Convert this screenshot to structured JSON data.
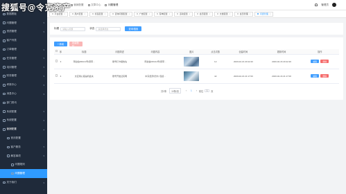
{
  "watermark": "搜狐号@令克资产",
  "header": {
    "breadcrumb": [
      "首页",
      "营销配置",
      "文章中心",
      "问题管理"
    ],
    "user": "管理员"
  },
  "tabs": [
    {
      "label": "平台配置",
      "active": false
    },
    {
      "label": "用户配置",
      "active": false
    },
    {
      "label": "标签配置",
      "active": false
    },
    {
      "label": "咨询问题配置",
      "active": false
    },
    {
      "label": "广告配置",
      "active": false
    },
    {
      "label": "菜单配置",
      "active": false
    },
    {
      "label": "活动配置",
      "active": false
    },
    {
      "label": "会员配置",
      "active": false
    },
    {
      "label": "文章配置",
      "active": false
    },
    {
      "label": "会员管理",
      "active": false
    },
    {
      "label": "问题管理",
      "active": true
    }
  ],
  "sidebar": {
    "items": [
      {
        "label": "数据看板",
        "level": 0,
        "arrow": false,
        "state": ""
      },
      {
        "label": "问题管理",
        "level": 0,
        "arrow": true,
        "state": ""
      },
      {
        "label": "资质管理",
        "level": 0,
        "arrow": true,
        "state": ""
      },
      {
        "label": "客户列表",
        "level": 0,
        "arrow": false,
        "state": ""
      },
      {
        "label": "订单管理",
        "level": 0,
        "arrow": true,
        "state": ""
      },
      {
        "label": "任务管理",
        "level": 0,
        "arrow": true,
        "state": ""
      },
      {
        "label": "培训管理",
        "level": 0,
        "arrow": true,
        "state": ""
      },
      {
        "label": "财务管理",
        "level": 0,
        "arrow": true,
        "state": ""
      },
      {
        "label": "考核中心",
        "level": 0,
        "arrow": true,
        "state": ""
      },
      {
        "label": "消息中心",
        "level": 0,
        "arrow": true,
        "state": ""
      },
      {
        "label": "部门资讯",
        "level": 0,
        "arrow": false,
        "state": ""
      },
      {
        "label": "系统配置",
        "level": 0,
        "arrow": true,
        "state": ""
      },
      {
        "label": "系统配置",
        "level": 0,
        "arrow": true,
        "state": ""
      },
      {
        "label": "营销配置",
        "level": 0,
        "arrow": true,
        "state": "open"
      },
      {
        "label": "首页配置",
        "level": 1,
        "arrow": false,
        "state": ""
      },
      {
        "label": "客户服务",
        "level": 1,
        "arrow": true,
        "state": ""
      },
      {
        "label": "解答事项",
        "level": 1,
        "arrow": true,
        "state": ""
      },
      {
        "label": "问题规则",
        "level": 2,
        "arrow": false,
        "state": ""
      },
      {
        "label": "问题管理",
        "level": 2,
        "arrow": false,
        "state": "active"
      },
      {
        "label": "关于我们",
        "level": 0,
        "arrow": true,
        "state": ""
      }
    ]
  },
  "filter": {
    "title_label": "标题",
    "title_placeholder": "请输入标题",
    "status_label": "状态",
    "status_placeholder": "请选择状态",
    "search_button": "查询/搜索"
  },
  "actions": {
    "add": "+ 新增",
    "batch_delete": "批量删除"
  },
  "table": {
    "headers": [
      "",
      "序",
      "标题",
      "问题简述",
      "问题内容",
      "图片",
      "点击次数",
      "创建时间",
      "更新时间",
      "操作"
    ],
    "rows": [
      {
        "index": "3",
        "title": "阿拉伯DRA11号(意带...",
        "summary": "账号打卡报告先",
        "content": "阿拉伯DRA11号(意带...",
        "clicks": "12",
        "created": "2020-02-16 20:42:20",
        "updated": "2020-02-16 20:42:20"
      },
      {
        "index": "4",
        "title": "文应用心度是机会关",
        "summary": "账号开发证实明",
        "content": "中东经济(托尔) 包括...",
        "clicks": "42",
        "created": "2020-02-16 21:17:00",
        "updated": "2020-02-16 21:17:00"
      }
    ],
    "edit_label": "编辑",
    "delete_label": "删除"
  },
  "pager": {
    "total": "共2条",
    "page_size": "10条/页",
    "prev": "‹",
    "current": "1",
    "next": "›",
    "goto": "前往",
    "goto_value": "1",
    "page_unit": "页"
  }
}
